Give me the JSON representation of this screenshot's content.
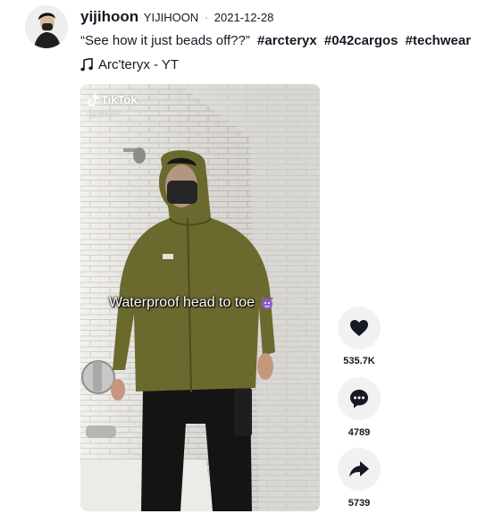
{
  "post": {
    "username": "yijihoon",
    "nickname": "YIJIHOON",
    "separator": "·",
    "date": "2021-12-28",
    "caption_text": "“See how it just beads off??”",
    "hashtags": [
      "#arcteryx",
      "#042cargos",
      "#techwear"
    ],
    "music": "Arc'teryx - YT"
  },
  "video": {
    "watermark_brand": "TikTok",
    "watermark_user": "@yijihoon",
    "overlay_text": "Waterproof head to toe"
  },
  "actions": {
    "likes": "535.7K",
    "comments": "4789",
    "shares": "5739"
  },
  "colors": {
    "text": "#161823",
    "action_bg": "#f1f1f2",
    "jacket": "#6b6a2e"
  },
  "icons": [
    "music-note-icon",
    "tiktok-logo-icon",
    "heart-icon",
    "comment-icon",
    "share-icon",
    "devil-emoji-icon"
  ]
}
